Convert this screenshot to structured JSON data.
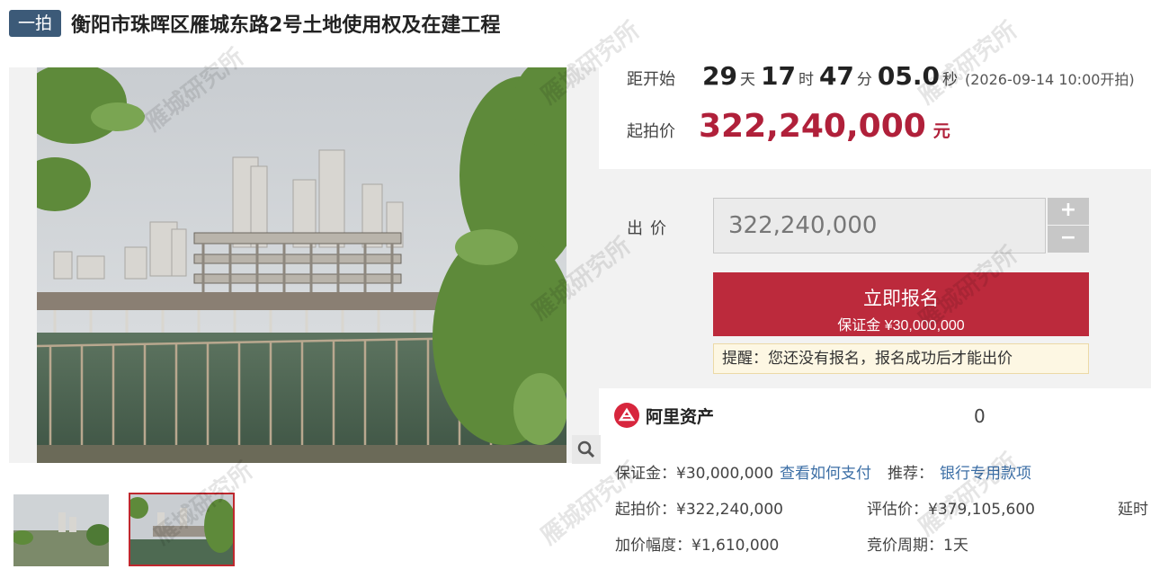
{
  "header": {
    "tag": "一拍",
    "title": "衡阳市珠晖区雁城东路2号土地使用权及在建工程"
  },
  "countdown": {
    "label": "距开始",
    "days": "29",
    "days_unit": "天",
    "hours": "17",
    "hours_unit": "时",
    "minutes": "47",
    "minutes_unit": "分",
    "seconds": "05.0",
    "seconds_unit": "秒",
    "start_time": "(2026-09-14 10:00开拍)"
  },
  "price": {
    "label": "起拍价",
    "value": "322,240,000",
    "unit": "元"
  },
  "bid": {
    "label": "出价",
    "input_value": "322,240,000",
    "plus": "+",
    "minus": "−",
    "signup_label": "立即报名",
    "deposit_text": "保证金 ¥30,000,000",
    "notice": "提醒：您还没有报名，报名成功后才能出价"
  },
  "platform": {
    "name": "阿里资产",
    "count": "0"
  },
  "details": {
    "deposit": "保证金：¥30,000,000",
    "how_to_pay": "查看如何支付",
    "recommend_label": "推荐：",
    "recommend_link": "银行专用款项",
    "start_price": "起拍价：¥322,240,000",
    "eval_price": "评估价：¥379,105,600",
    "delay": "延时",
    "increment": "加价幅度：¥1,610,000",
    "cycle": "竞价周期：1天"
  },
  "watermark": "雁城研究所",
  "colors": {
    "accent": "#bc2a3c",
    "price": "#b0203a",
    "tag_bg": "#3c5a78",
    "link": "#3b6ea5"
  }
}
